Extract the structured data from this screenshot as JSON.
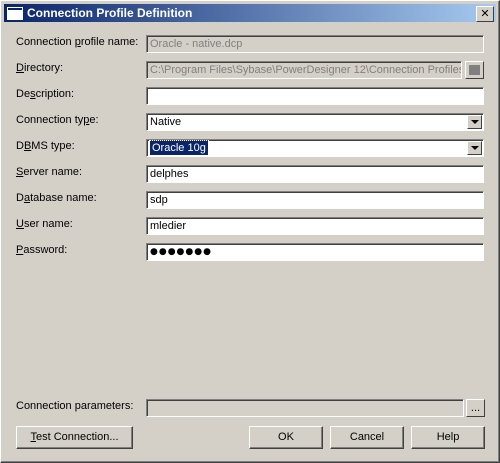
{
  "window": {
    "title": "Connection Profile Definition",
    "close_glyph": "✕"
  },
  "fields": {
    "profile_name": {
      "label_pre": "Connection ",
      "label_key": "p",
      "label_post": "rofile name:",
      "value": "Oracle - native.dcp"
    },
    "directory": {
      "label_pre": "",
      "label_key": "D",
      "label_post": "irectory:",
      "value": "C:\\Program Files\\Sybase\\PowerDesigner 12\\Connection Profiles\\"
    },
    "description": {
      "label_pre": "De",
      "label_key": "s",
      "label_post": "cription:",
      "value": ""
    },
    "connection_type": {
      "label_pre": "Connection ty",
      "label_key": "p",
      "label_post": "e:",
      "value": "Native"
    },
    "dbms_type": {
      "label_pre": "D",
      "label_key": "B",
      "label_post": "MS type:",
      "value": "Oracle 10g"
    },
    "server_name": {
      "label_pre": "",
      "label_key": "S",
      "label_post": "erver name:",
      "value": "delphes"
    },
    "database_name": {
      "label_pre": "D",
      "label_key": "a",
      "label_post": "tabase name:",
      "value": "sdp"
    },
    "user_name": {
      "label_pre": "",
      "label_key": "U",
      "label_post": "ser name:",
      "value": "mledier"
    },
    "password": {
      "label_pre": "",
      "label_key": "P",
      "label_post": "assword:",
      "value": "●●●●●●●"
    },
    "connection_parameters": {
      "label": "Connection parameters:",
      "value": "",
      "button": "..."
    }
  },
  "buttons": {
    "test_pre": "",
    "test_key": "T",
    "test_post": "est Connection...",
    "ok": "OK",
    "cancel": "Cancel",
    "help": "Help"
  }
}
